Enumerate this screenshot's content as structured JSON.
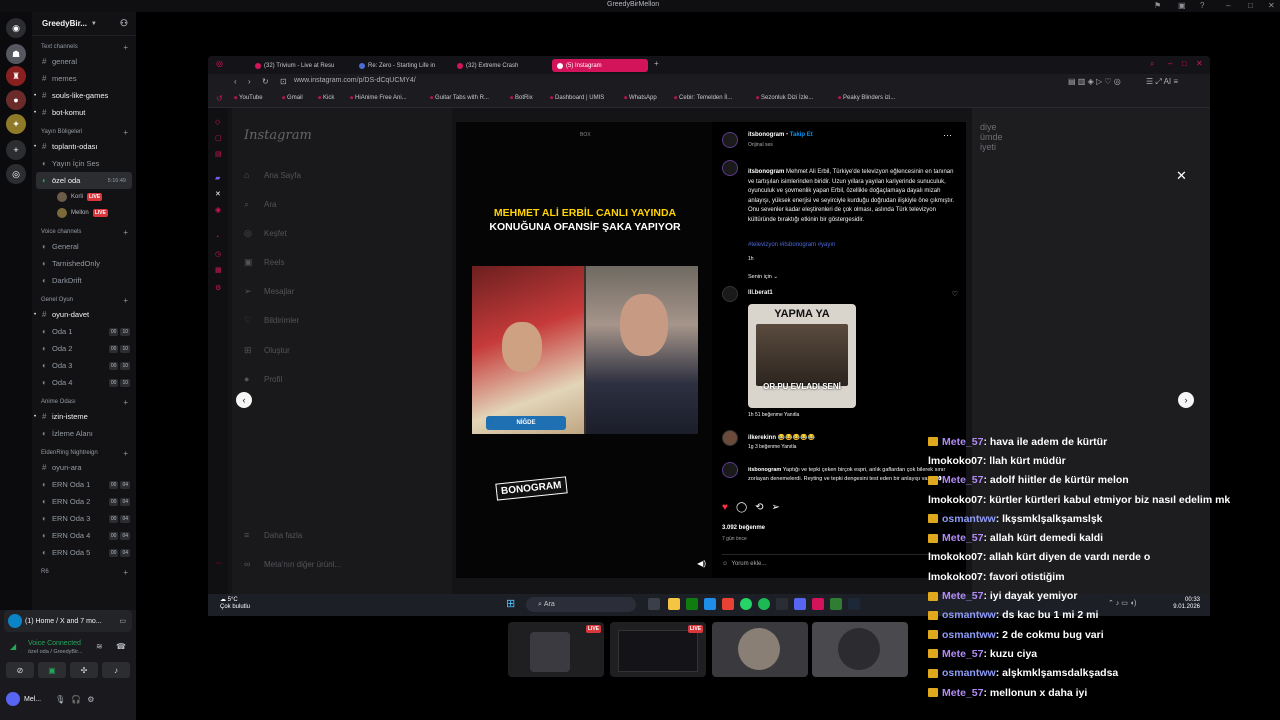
{
  "discord": {
    "window_title": "GreedyBirMellon",
    "guild_name": "GreedyBir...",
    "categories": [
      {
        "name": "Text channels",
        "channels": [
          "general",
          "memes",
          "souls-like-games",
          "bot-komut"
        ]
      },
      {
        "name": "Yayın Böligeleri",
        "channels": [
          "toplantı-odası",
          "Yayın İçin Ses"
        ]
      },
      {
        "name": "Voice channels",
        "channels": [
          "General",
          "TarnishedOnly",
          "DarkDrift"
        ]
      },
      {
        "name": "Genel Oyun",
        "channels": [
          "oyun-davet",
          "Oda 1",
          "Oda 2",
          "Oda 3",
          "Oda 4"
        ]
      },
      {
        "name": "Anime Odası",
        "channels": [
          "izin-isteme",
          "İzleme Alanı"
        ]
      },
      {
        "name": "EldenRing Nightreign",
        "channels": [
          "oyun-ara",
          "ERN Oda 1",
          "ERN Oda 2",
          "ERN Oda 3",
          "ERN Oda 4",
          "ERN Oda 5"
        ]
      }
    ],
    "selected_channel": "özel oda",
    "selected_channel_time": "5:16:49",
    "voice_users": [
      {
        "name": "Korli",
        "badge": "LIVE"
      },
      {
        "name": "Mellon",
        "badge": "LIVE"
      }
    ],
    "room_counts": [
      "00",
      "10"
    ],
    "ern_counts": [
      "00",
      "04"
    ],
    "cat_tail": "R6",
    "stream_card": "(1) Home / X and 7 mo...",
    "voice_connected": "Voice Connected",
    "voice_sub": "özel oda / GreedyBir...",
    "me_name": "Mel..."
  },
  "browser": {
    "tabs": [
      "(32) Trivium - Live at Resu",
      "Re: Zero - Starting Life in",
      "(32) Extreme Crash",
      "(5) Instagram"
    ],
    "url": "www.instagram.com/p/DS-dCqUCMY4/",
    "bookmarks": [
      "YouTube",
      "Gmail",
      "Kick",
      "HiAnime Free Ani...",
      "Guitar Tabs with R...",
      "BotRix",
      "Dashboard | UMIS",
      "WhatsApp",
      "Cebir: Temelden İl...",
      "Sezonluk Dizi İzle...",
      "Peaky Blinders izi..."
    ]
  },
  "instagram": {
    "logo": "Instagram",
    "nav": [
      "Ana Sayfa",
      "Ara",
      "Keşfet",
      "Reels",
      "Mesajlar",
      "Bildirimler",
      "Oluştur",
      "Profil",
      "Daha fazla",
      "Meta'nın diğer ürünl..."
    ],
    "headline_1": "MEHMET ALİ ERBİL CANLI YAYINDA",
    "headline_2": "KONUĞUNA OFANSİF ŞAKA YAPIYOR",
    "lower_third": "NİĞDE",
    "brand": "BONOGRAM",
    "box_label": "BOX",
    "author": "itsbonogram",
    "follow": "Takip Et",
    "audio": "Orijinal ses",
    "caption": "Mehmet Ali Erbil, Türkiye'de televizyon eğlencesinin en tanınan ve tartışılan isimlerinden biridir. Uzun yıllara yayılan kariyerinde sunuculuk, oyunculuk ve şovmenlik yapan Erbil, özellikle doğaçlamaya dayalı mizah anlayışı, yüksek enerjisi ve seyirciyle kurduğu doğrudan ilişkiyle öne çıkmıştır. Onu sevenler kadar eleştirenleri de çok olması, aslında Türk televizyon kültüründe bıraktığı etkinin bir göstergesidir.",
    "hashtags": "#televizyon #itsbonogram #yayın",
    "caption_time": "1h",
    "for_you": "Senin için",
    "comment1_user": "lll.berat1",
    "meme_top": "YAPMA YA",
    "meme_bottom": "OR   PU EVLADI SENİ",
    "comment1_meta": "1h   51 beğenme   Yanıtla",
    "comment2_user": "ilkerekinn",
    "comment2_text": "😂😂😂😂😂",
    "comment2_meta": "1g   3 beğenme   Yanıtla",
    "comment3_user": "itsbonogram",
    "comment3_text": "Yaptığı ve tepki çeken birçok espri, anlık gaflardan çok bilerek sınır zorlayan denemelerdi. Reyting ve tepki dengesini test eden bir anlayışı vardı 👀",
    "likes": "3.092 beğenme",
    "posted": "7 gün önce",
    "add_comment": "Yorum ekle...",
    "right_hint": "diye\nümde\niyeti"
  },
  "taskbar": {
    "weather_temp": "5°C",
    "weather_desc": "Çok bulutlu",
    "search": "Ara",
    "time": "00:33",
    "date": "9.01.2026"
  },
  "previews": [
    "LIVE",
    "LIVE"
  ],
  "chat": [
    {
      "user": "Mete_57",
      "text": " : hava ile adem de kürtür",
      "color": "mete"
    },
    {
      "user": "lmokoko07",
      "text": " : llah kürt müdür",
      "color": "imok"
    },
    {
      "user": "Mete_57",
      "text": " : adolf hiitler de kürtür melon",
      "color": "mete"
    },
    {
      "user": "lmokoko07",
      "text": " : kürtler kürtleri kabul etmiyor biz nasıl edelim mk",
      "color": "imok"
    },
    {
      "user": "osmantww",
      "text": " : lkşsmklşalkşamslşk",
      "color": "osman"
    },
    {
      "user": "Mete_57",
      "text": " : allah kürt demedi kaldi",
      "color": "mete"
    },
    {
      "user": "lmokoko07",
      "text": " : allah kürt diyen de vardı nerde o",
      "color": "imok"
    },
    {
      "user": "lmokoko07",
      "text": " : favori otistiğim",
      "color": "imok"
    },
    {
      "user": "Mete_57",
      "text": " : iyi dayak yemiyor",
      "color": "mete"
    },
    {
      "user": "osmantww",
      "text": " : ds kac bu 1 mi 2 mi",
      "color": "osman"
    },
    {
      "user": "osmantww",
      "text": " : 2 de cokmu bug vari",
      "color": "osman"
    },
    {
      "user": "Mete_57",
      "text": " : kuzu ciya",
      "color": "mete"
    },
    {
      "user": "osmantww",
      "text": " : alşkmklşamsdalkşadsa",
      "color": "osman"
    },
    {
      "user": "Mete_57",
      "text": " : mellonun x daha iyi",
      "color": "mete"
    }
  ]
}
